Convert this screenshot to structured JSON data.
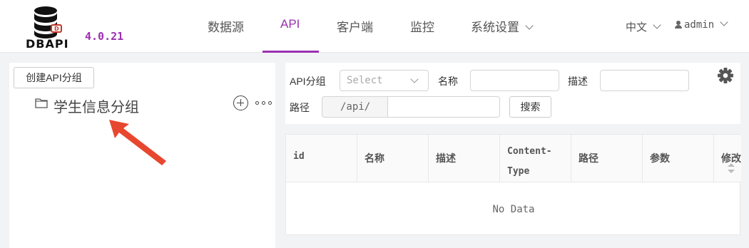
{
  "brand": {
    "name": "DBAPI",
    "version": "4.0.21",
    "accent": "#9b30b0"
  },
  "nav": {
    "items": [
      {
        "label": "数据源"
      },
      {
        "label": "API",
        "active": true
      },
      {
        "label": "客户端"
      },
      {
        "label": "监控"
      },
      {
        "label": "系统设置"
      }
    ],
    "language": "中文",
    "user": "admin"
  },
  "sidebar": {
    "create_button": "创建API分组",
    "groups": [
      {
        "label": "学生信息分组"
      }
    ]
  },
  "filters": {
    "group_label": "API分组",
    "group_placeholder": "Select",
    "name_label": "名称",
    "desc_label": "描述",
    "path_label": "路径",
    "path_prefix": "/api/",
    "search_button": "搜索"
  },
  "table": {
    "columns": [
      "id",
      "名称",
      "描述",
      "Content-\nType",
      "路径",
      "参数",
      "修改"
    ],
    "empty_text": "No Data"
  }
}
